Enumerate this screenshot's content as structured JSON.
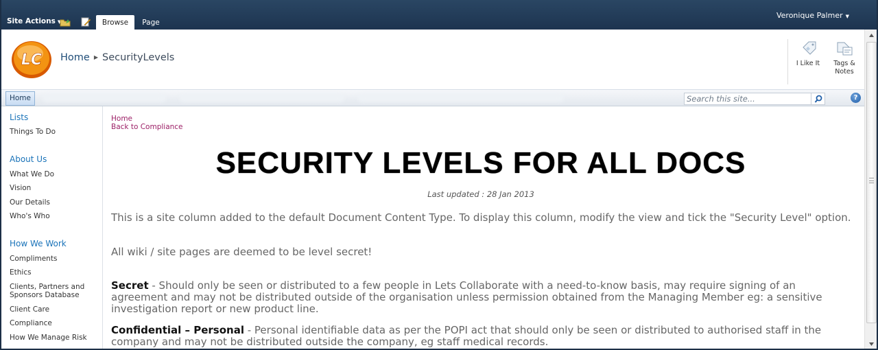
{
  "ribbon": {
    "site_actions": "Site Actions",
    "tabs": [
      {
        "label": "Browse",
        "selected": true
      },
      {
        "label": "Page",
        "selected": false
      }
    ],
    "user_name": "Veronique Palmer"
  },
  "header": {
    "logo_text": "LC",
    "breadcrumb": {
      "home": "Home",
      "current": "SecurityLevels"
    },
    "social": {
      "like_label": "I Like It",
      "tags_label_line1": "Tags &",
      "tags_label_line2": "Notes"
    }
  },
  "topnav": {
    "home_label": "Home",
    "search_placeholder": "Search this site...",
    "help_label": "?"
  },
  "sidebar": {
    "sections": [
      {
        "heading": "Lists",
        "items": [
          "Things To Do"
        ]
      },
      {
        "heading": "About Us",
        "items": [
          "What We Do",
          "Vision",
          "Our Details",
          "Who's Who"
        ]
      },
      {
        "heading": "How We Work",
        "items": [
          "Compliments",
          "Ethics",
          "Clients, Partners and Sponsors Database",
          "Client Care",
          "Compliance",
          "How We Manage Risk"
        ]
      }
    ]
  },
  "main": {
    "links": {
      "home": "Home",
      "back": "Back to Compliance"
    },
    "heading": "SECURITY LEVELS FOR ALL DOCS",
    "last_updated": "Last updated : 28 Jan 2013",
    "intro": "This is a site column added to the default Document Content Type.  To display this column, modify the view and tick the \"Security Level\" option.",
    "wiki_note": "All wiki / site pages are deemed to be level secret!",
    "levels": [
      {
        "name": "Secret",
        "description": " - Should only be seen or distributed to a few people in Lets Collaborate with a need-to-know basis, may require signing of an agreement and may not be distributed outside of the organisation unless permission obtained from the Managing Member eg: a sensitive investigation report or new product line."
      },
      {
        "name": "Confidential – Personal",
        "description": " - Personal identifiable data as per the POPI act that should only be seen or distributed to authorised staff in the company and may not be distributed outside the company, eg staff medical records."
      }
    ]
  },
  "colors": {
    "ribbon_bg": "#1d3450",
    "link_blue": "#1a73b9",
    "link_magenta": "#9c1f66",
    "logo_orange": "#f07d00"
  }
}
